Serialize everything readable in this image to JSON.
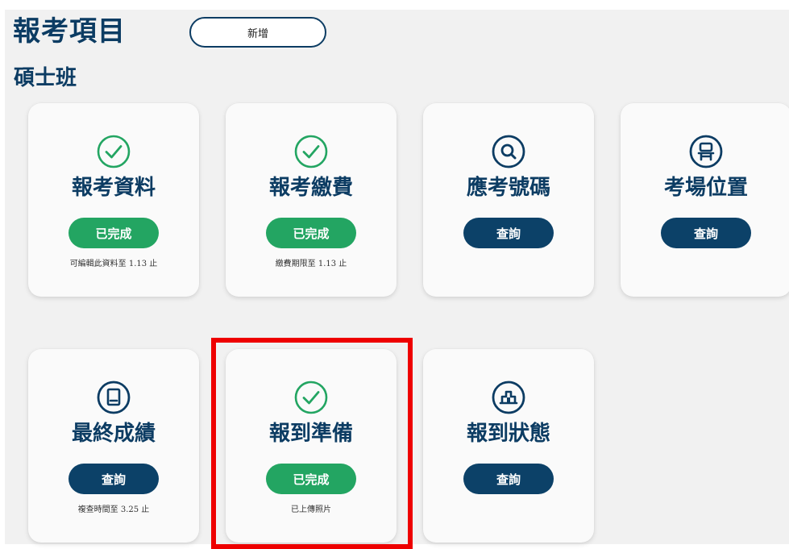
{
  "header": {
    "title": "報考項目",
    "add_label": "新增"
  },
  "section": {
    "title": "碩士班"
  },
  "cards": [
    {
      "title": "報考資料",
      "icon": "check-circle-icon",
      "status": "已完成",
      "status_type": "done",
      "note": "可編輯此資料至 1.13 止"
    },
    {
      "title": "報考繳費",
      "icon": "check-circle-icon",
      "status": "已完成",
      "status_type": "done",
      "note": "繳費期限至 1.13 止"
    },
    {
      "title": "應考號碼",
      "icon": "search-circle-icon",
      "status": "查詢",
      "status_type": "query",
      "note": ""
    },
    {
      "title": "考場位置",
      "icon": "seat-circle-icon",
      "status": "查詢",
      "status_type": "query",
      "note": ""
    },
    {
      "title": "最終成績",
      "icon": "document-circle-icon",
      "status": "查詢",
      "status_type": "query",
      "note": "複查時間至 3.25 止"
    },
    {
      "title": "報到準備",
      "icon": "check-circle-icon",
      "status": "已完成",
      "status_type": "done",
      "note": "已上傳照片"
    },
    {
      "title": "報到狀態",
      "icon": "building-circle-icon",
      "status": "查詢",
      "status_type": "query",
      "note": ""
    }
  ],
  "colors": {
    "primary": "#0c3c63",
    "done": "#23a562",
    "query": "#0c4168",
    "highlight": "#ee0000"
  }
}
